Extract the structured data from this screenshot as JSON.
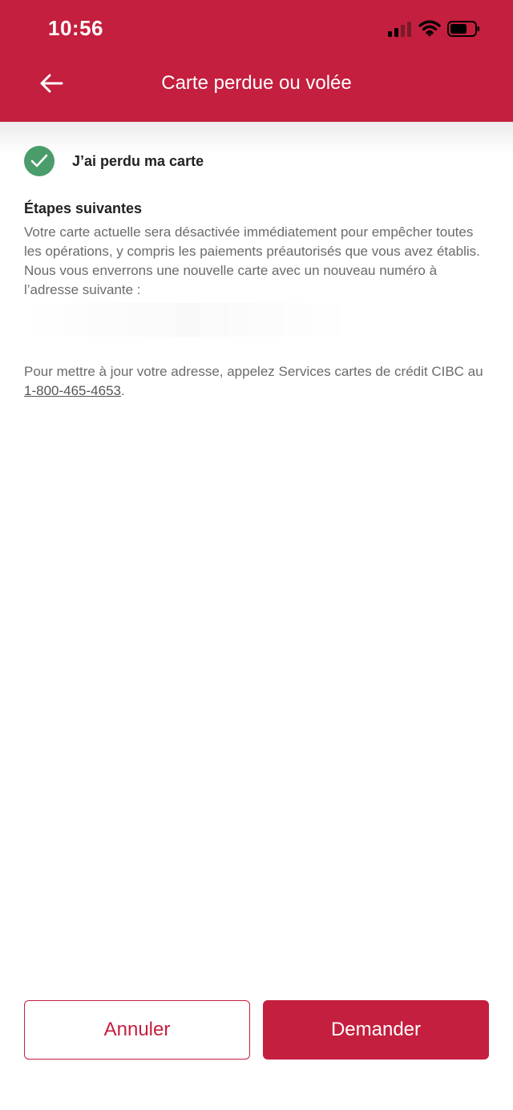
{
  "status_bar": {
    "time": "10:56"
  },
  "header": {
    "title": "Carte perdue ou volée",
    "back_icon": "arrow-left-icon"
  },
  "reason": {
    "icon": "check-circle-icon",
    "label": "J’ai perdu ma carte"
  },
  "steps": {
    "title": "Étapes suivantes",
    "body": "Votre carte actuelle sera désactivée immédiatement pour empêcher toutes les opérations, y compris les paiements préautorisés que vous avez établis. Nous vous enverrons une nouvelle carte avec un nouveau numéro à l’adresse suivante :"
  },
  "update": {
    "text_before": "Pour mettre à jour votre adresse, appelez Services cartes de crédit CIBC au ",
    "phone": "1-800-465-4653",
    "text_after": "."
  },
  "buttons": {
    "cancel": "Annuler",
    "submit": "Demander"
  },
  "colors": {
    "brand": "#c41f3e",
    "success": "#4a9d6a"
  }
}
